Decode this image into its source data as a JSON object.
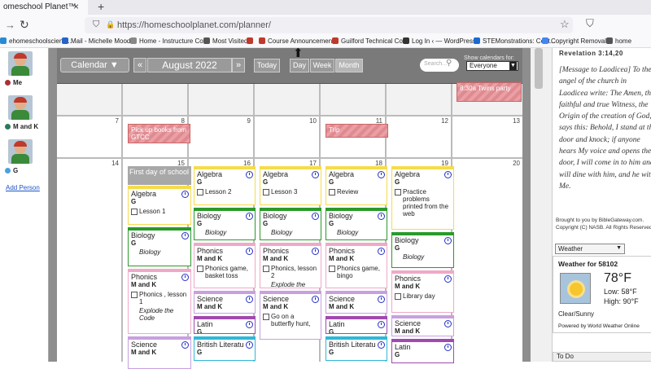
{
  "browser": {
    "tab_title": "omeschool Planet™",
    "tab_close": "×",
    "new_tab": "+",
    "url": "https://homeschoolplanet.com/planner/",
    "bookmarks": [
      {
        "label": "ehomeschoolscienti...",
        "color": "#2a8ad4"
      },
      {
        "label": "Mail - Michelle Mood...",
        "color": "#2563c9"
      },
      {
        "label": "Home - Instructure Co...",
        "color": "#888888"
      },
      {
        "label": "Most Visited",
        "color": "#555555"
      },
      {
        "label": "",
        "color": "#c0392b"
      },
      {
        "label": "Course Announcements",
        "color": "#c0392b"
      },
      {
        "label": "Guilford Technical Co...",
        "color": "#c0392b"
      },
      {
        "label": "Log In ‹ — WordPress",
        "color": "#333333"
      },
      {
        "label": "STEMonstrations: Cent...",
        "color": "#1a6ad4"
      },
      {
        "label": "Copyright Removal",
        "color": "#4285f4"
      },
      {
        "label": "home",
        "color": "#555555"
      }
    ]
  },
  "people": [
    {
      "label": "Me",
      "color": "#a83232"
    },
    {
      "label": "M and K",
      "color": "#2a7a5a"
    },
    {
      "label": "G",
      "color": "#4aa0e0"
    }
  ],
  "add_person": "Add Person",
  "toolbar": {
    "calendar_btn": "Calendar ▼",
    "prev": "«",
    "next": "»",
    "month": "August 2022",
    "today": "Today",
    "day": "Day",
    "week": "Week",
    "month_view": "Month",
    "search_placeholder": "Search...",
    "show_label": "Show calendars for:",
    "selected": "Everyone"
  },
  "days": [
    "7",
    "8",
    "9",
    "10",
    "11",
    "12",
    "13",
    "14",
    "15",
    "16",
    "17",
    "18",
    "19",
    "20"
  ],
  "bars": {
    "twins": "8:30a Twins party",
    "pickup": "Pick up books from GTCC",
    "trip": "Trip",
    "first_day": "First day of school"
  },
  "events": {
    "mon": [
      {
        "title": "Algebra",
        "who": "G",
        "task": "Lesson 1",
        "note": "",
        "color": "#f5dc4a"
      },
      {
        "title": "Biology",
        "who": "G",
        "task": "",
        "note": "Biology",
        "color": "#2a9a2a"
      },
      {
        "title": "Phonics",
        "who": "M and K",
        "task": "Phonics , lesson 1",
        "note": "Explode the Code",
        "color": "#f0a8c8"
      },
      {
        "title": "Science",
        "who": "M and K",
        "task": "",
        "note": "",
        "color": "#c8a0e0"
      }
    ],
    "tue": [
      {
        "title": "Algebra",
        "who": "G",
        "task": "Lesson 2",
        "note": "",
        "color": "#f5dc4a"
      },
      {
        "title": "Biology",
        "who": "G",
        "task": "",
        "note": "Biology",
        "color": "#2a9a2a"
      },
      {
        "title": "Phonics",
        "who": "M and K",
        "task": "Phonics game, basket toss",
        "note": "",
        "color": "#f0a8c8"
      },
      {
        "title": "Science",
        "who": "M and K",
        "task": "",
        "note": "",
        "color": "#c8a0e0"
      },
      {
        "title": "Latin",
        "who": "G",
        "task": "",
        "note": "",
        "color": "#a04ab0"
      },
      {
        "title": "British Literatu",
        "who": "G",
        "task": "",
        "note": "",
        "color": "#30b8d8"
      }
    ],
    "wed": [
      {
        "title": "Algebra",
        "who": "G",
        "task": "Lesson 3",
        "note": "",
        "color": "#f5dc4a"
      },
      {
        "title": "Biology",
        "who": "G",
        "task": "",
        "note": "Biology",
        "color": "#2a9a2a"
      },
      {
        "title": "Phonics",
        "who": "M and K",
        "task": "Phonics, lesson 2",
        "note": "Explode the Code",
        "color": "#f0a8c8"
      },
      {
        "title": "Science",
        "who": "M and K",
        "task": "Go on a butterfly hunt,",
        "note": "",
        "color": "#c8a0e0"
      }
    ],
    "thu": [
      {
        "title": "Algebra",
        "who": "G",
        "task": "Review",
        "note": "",
        "color": "#f5dc4a"
      },
      {
        "title": "Biology",
        "who": "G",
        "task": "",
        "note": "Biology",
        "color": "#2a9a2a"
      },
      {
        "title": "Phonics",
        "who": "M and K",
        "task": "Phonics game, bingo",
        "note": "",
        "color": "#f0a8c8"
      },
      {
        "title": "Science",
        "who": "M and K",
        "task": "",
        "note": "",
        "color": "#c8a0e0"
      },
      {
        "title": "Latin",
        "who": "G",
        "task": "",
        "note": "",
        "color": "#a04ab0"
      },
      {
        "title": "British Literatu",
        "who": "G",
        "task": "",
        "note": "",
        "color": "#30b8d8"
      }
    ],
    "fri": [
      {
        "title": "Algebra",
        "who": "G",
        "task": "Practice problems printed from the web",
        "note": "",
        "color": "#f5dc4a"
      },
      {
        "title": "Biology",
        "who": "G",
        "task": "",
        "note": "Biology",
        "color": "#2a9a2a"
      },
      {
        "title": "Phonics",
        "who": "M and K",
        "task": "Library day",
        "note": "",
        "color": "#f0a8c8"
      },
      {
        "title": "Science",
        "who": "M and K",
        "task": "",
        "note": "",
        "color": "#c8a0e0"
      },
      {
        "title": "Latin",
        "who": "G",
        "task": "",
        "note": "",
        "color": "#a04ab0"
      }
    ]
  },
  "verse": {
    "ref": "Revelation 3:14,20",
    "text": "[Message to Laodicea] To the angel of the church in Laodicea write: The Amen, the faithful and true Witness, the Origin of the creation of God, says this: Behold, I stand at the door and knock; if anyone hears My voice and opens the door, I will come in to him and will dine with him, and he with Me.",
    "credit": "Brought to you by BibleGateway.com. Copyright (C) NASB. All Rights Reserved."
  },
  "weather": {
    "select": "Weather",
    "title": "Weather for 58102",
    "temp": "78°F",
    "low": "Low: 58°F",
    "high": "High: 90°F",
    "cond": "Clear/Sunny",
    "powered": "Powered by World Weather Online"
  },
  "todo": "To Do"
}
